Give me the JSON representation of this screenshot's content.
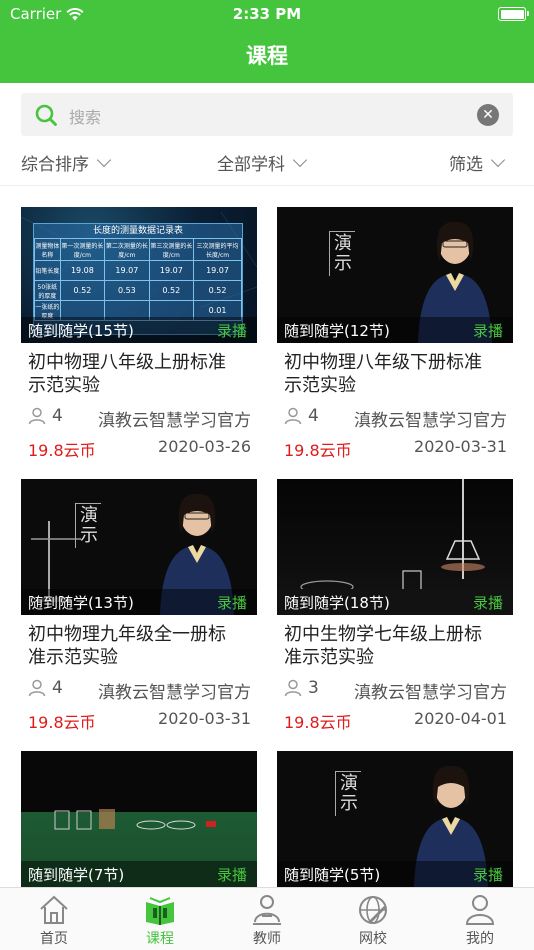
{
  "status": {
    "carrier": "Carrier",
    "time": "2:33 PM"
  },
  "title": "课程",
  "search": {
    "placeholder": "搜索"
  },
  "filters": [
    "综合排序",
    "全部学科",
    "筛选"
  ],
  "courses": [
    {
      "title_line1": "初中物理八年级上册标准",
      "title_line2": "示范实验",
      "sessions": "随到随学(15节)",
      "rec": "录播",
      "students": "4",
      "owner": "滇教云智慧学习官方",
      "price": "19.8云币",
      "date": "2020-03-26",
      "table": {
        "title": "长度的测量数据记录表",
        "headers": [
          "测量物体名称",
          "第一次测量的长度/cm",
          "第二次测量的长度/cm",
          "第三次测量的长度/cm",
          "三次测量的平均长度/cm"
        ],
        "rows": [
          [
            "铅笔长度",
            "19.08",
            "19.07",
            "19.07",
            "19.07"
          ],
          [
            "50张纸的厚度",
            "0.52",
            "0.53",
            "0.52",
            "0.52"
          ],
          [
            "一张纸的厚度",
            "",
            "",
            "",
            "0.01"
          ]
        ]
      }
    },
    {
      "title_line1": "初中物理八年级下册标准",
      "title_line2": "示范实验",
      "sessions": "随到随学(12节)",
      "rec": "录播",
      "students": "4",
      "owner": "滇教云智慧学习官方",
      "price": "19.8云币",
      "date": "2020-03-31",
      "sign": "演示"
    },
    {
      "title_line1": "初中物理九年级全一册标",
      "title_line2": "准示范实验",
      "sessions": "随到随学(13节)",
      "rec": "录播",
      "students": "4",
      "owner": "滇教云智慧学习官方",
      "price": "19.8云币",
      "date": "2020-03-31",
      "sign": "演示"
    },
    {
      "title_line1": "初中生物学七年级上册标",
      "title_line2": "准示范实验",
      "sessions": "随到随学(18节)",
      "rec": "录播",
      "students": "3",
      "owner": "滇教云智慧学习官方",
      "price": "19.8云币",
      "date": "2020-04-01"
    },
    {
      "sessions": "随到随学(7节)",
      "rec": "录播"
    },
    {
      "sessions": "随到随学(5节)",
      "rec": "录播",
      "sign": "演示"
    }
  ],
  "tabs": [
    "首页",
    "课程",
    "教师",
    "网校",
    "我的"
  ],
  "colors": {
    "accent": "#45c43d",
    "price": "#e01b1b"
  }
}
